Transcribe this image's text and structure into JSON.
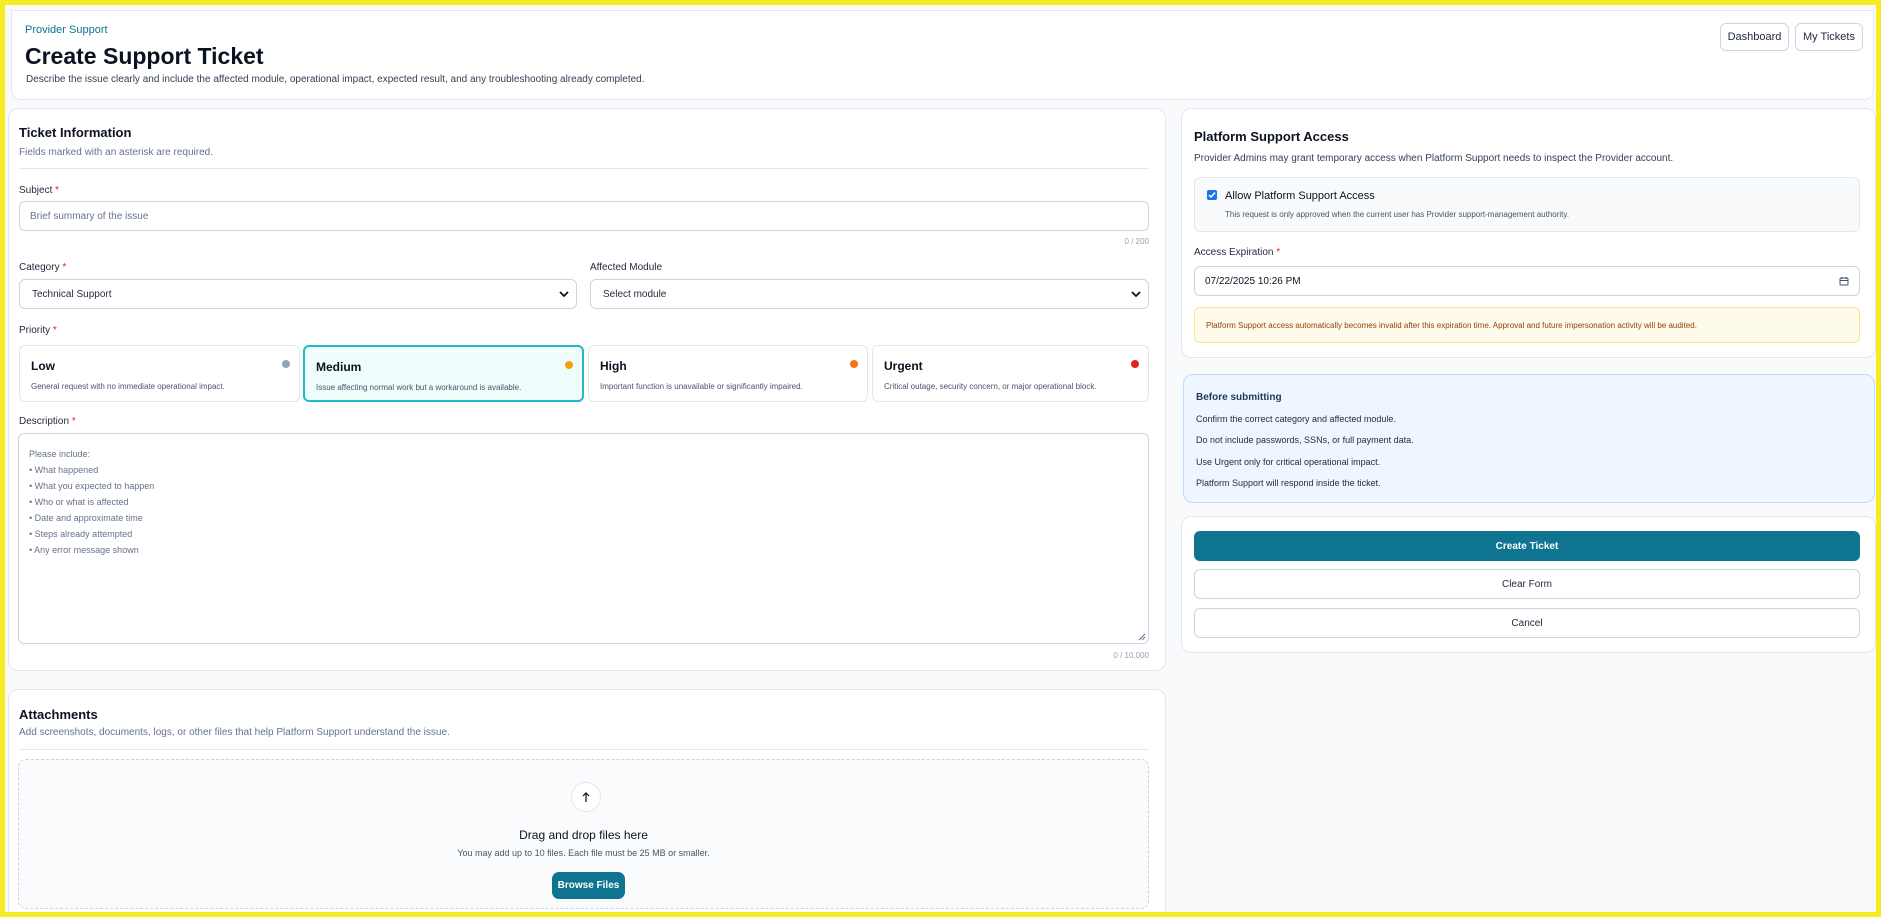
{
  "header": {
    "eyebrow": "Provider Support",
    "title": "Create Support Ticket",
    "subtitle": "Describe the issue clearly and include the affected module, operational impact, expected result, and any troubleshooting already completed.",
    "dashboard_label": "Dashboard",
    "my_tickets_label": "My Tickets"
  },
  "ticket": {
    "title": "Ticket Information",
    "subtitle": "Fields marked with an asterisk are required.",
    "subject_label": "Subject",
    "subject_placeholder": "Brief summary of the issue",
    "subject_counter": "0 / 200",
    "category_label": "Category",
    "category_value": "Technical Support",
    "module_label": "Affected Module",
    "module_value": "Select module",
    "priority_label": "Priority",
    "priorities": [
      {
        "name": "Low",
        "desc": "General request with no immediate operational impact.",
        "color": "#94a3b8"
      },
      {
        "name": "Medium",
        "desc": "Issue affecting normal work but a workaround is available.",
        "color": "#f59e0b"
      },
      {
        "name": "High",
        "desc": "Important function is unavailable or significantly impaired.",
        "color": "#f97316"
      },
      {
        "name": "Urgent",
        "desc": "Critical outage, security concern, or major operational block.",
        "color": "#dc2626"
      }
    ],
    "selected_priority": "Medium",
    "description_label": "Description",
    "description_placeholder": [
      "Please include:",
      "• What happened",
      "• What you expected to happen",
      "• Who or what is affected",
      "• Date and approximate time",
      "• Steps already attempted",
      "• Any error message shown"
    ],
    "description_counter": "0 / 10,000"
  },
  "attachments": {
    "title": "Attachments",
    "subtitle": "Add screenshots, documents, logs, or other files that help Platform Support understand the issue.",
    "drop_title": "Drag and drop files here",
    "drop_sub": "You may add up to 10 files. Each file must be 25 MB or smaller.",
    "browse_label": "Browse Files"
  },
  "access": {
    "title": "Platform Support Access",
    "subtitle": "Provider Admins may grant temporary access when Platform Support needs to inspect the Provider account.",
    "allow_label": "Allow Platform Support Access",
    "allow_checked": true,
    "allow_help": "This request is only approved when the current user has Provider support-management authority.",
    "expiration_label": "Access Expiration",
    "expiration_value": "07/22/2025 10:26 PM",
    "warning": "Platform Support access automatically becomes invalid after this expiration time. Approval and future impersonation activity will be audited."
  },
  "before": {
    "title": "Before submitting",
    "items": [
      "Confirm the correct category and affected module.",
      "Do not include passwords, SSNs, or full payment data.",
      "Use Urgent only for critical operational impact.",
      "Platform Support will respond inside the ticket."
    ]
  },
  "actions": {
    "create_label": "Create Ticket",
    "clear_label": "Clear Form",
    "cancel_label": "Cancel"
  },
  "colors": {
    "accent": "#0e7490",
    "highlight_border": "#22b8c8",
    "frame": "#f7ec1f"
  }
}
